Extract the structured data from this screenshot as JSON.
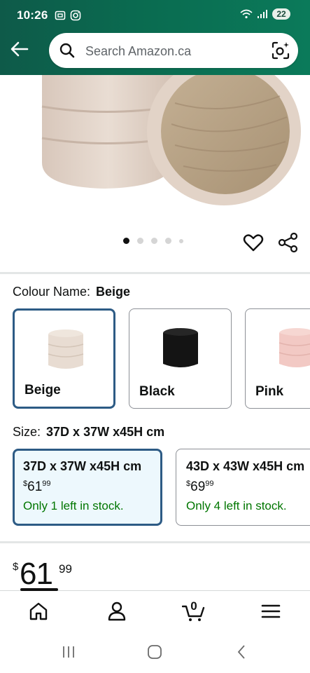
{
  "status": {
    "time": "10:26",
    "battery": "22"
  },
  "search": {
    "placeholder": "Search Amazon.ca"
  },
  "gallery": {
    "image_count": 5,
    "active_index": 0
  },
  "colour": {
    "label": "Colour Name:",
    "selected": "Beige",
    "options": [
      {
        "label": "Beige",
        "color": "#e8dcd2"
      },
      {
        "label": "Black",
        "color": "#141414"
      },
      {
        "label": "Pink",
        "color": "#f2c9c4"
      }
    ]
  },
  "size": {
    "label": "Size:",
    "selected": "37D x 37W x45H cm",
    "options": [
      {
        "name": "37D x 37W x45H cm",
        "price_symbol": "$",
        "price_whole": "61",
        "price_fraction": "99",
        "stock": "Only 1 left in stock."
      },
      {
        "name": "43D x 43W x45H cm",
        "price_symbol": "$",
        "price_whole": "69",
        "price_fraction": "99",
        "stock": "Only 4 left in stock."
      }
    ]
  },
  "price": {
    "symbol": "$",
    "whole": "61",
    "fraction": "99"
  },
  "cart": {
    "count": "0"
  },
  "colors": {
    "header_green": "#0b6b50",
    "selected_border": "#2d5b85",
    "stock_green": "#007600"
  }
}
